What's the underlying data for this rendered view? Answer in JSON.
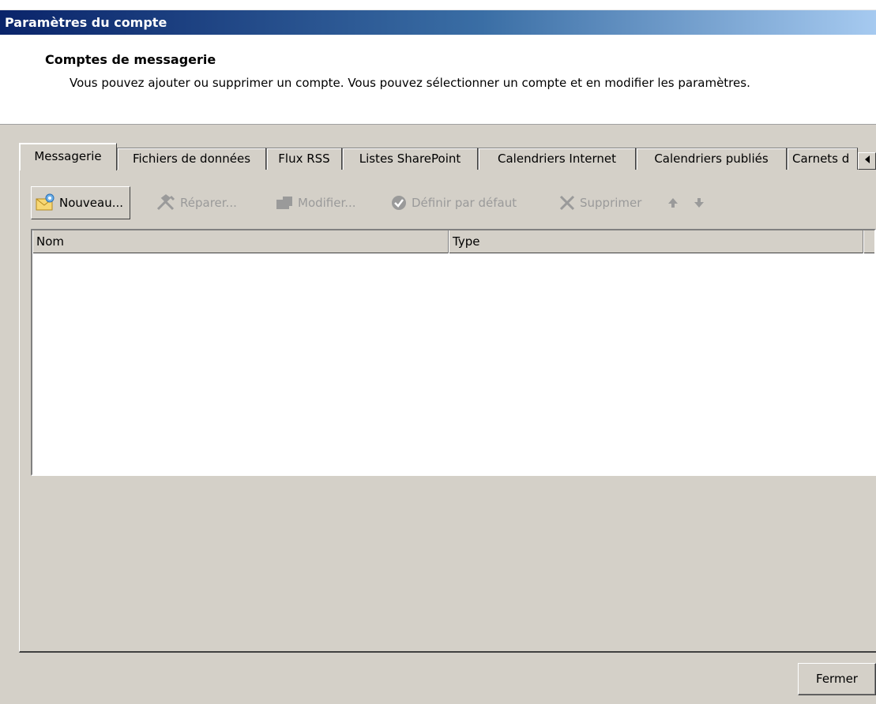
{
  "window": {
    "title": "Paramètres du compte"
  },
  "header": {
    "title": "Comptes de messagerie",
    "description": "Vous pouvez ajouter ou supprimer un compte. Vous pouvez sélectionner un compte et en modifier les paramètres."
  },
  "tabs": [
    {
      "label": "Messagerie",
      "active": true
    },
    {
      "label": "Fichiers de données",
      "active": false
    },
    {
      "label": "Flux RSS",
      "active": false
    },
    {
      "label": "Listes SharePoint",
      "active": false
    },
    {
      "label": "Calendriers Internet",
      "active": false
    },
    {
      "label": "Calendriers publiés",
      "active": false
    },
    {
      "label": "Carnets d",
      "active": false
    }
  ],
  "tab_scroll": {
    "icon": "scroll-left-icon"
  },
  "toolbar": {
    "new_label": "Nouveau...",
    "repair_label": "Réparer...",
    "modify_label": "Modifier...",
    "default_label": "Définir par défaut",
    "delete_label": "Supprimer",
    "enabled": [
      "new"
    ],
    "disabled_color": "#9a9a9a"
  },
  "list": {
    "columns": [
      "Nom",
      "Type"
    ],
    "rows": []
  },
  "footer": {
    "close_label": "Fermer"
  },
  "colors": {
    "titlebar_start": "#0a246a",
    "titlebar_end": "#a6caf0",
    "face": "#d4d0c8"
  }
}
